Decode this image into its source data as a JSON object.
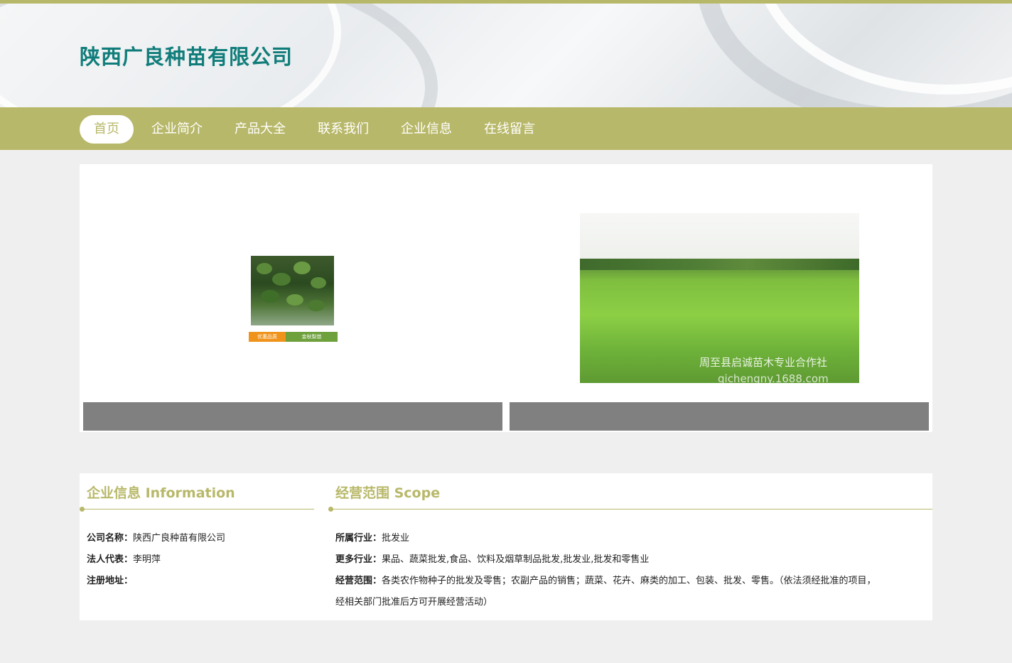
{
  "header": {
    "company_name": "陕西广良种苗有限公司"
  },
  "nav": {
    "items": [
      "首页",
      "企业简介",
      "产品大全",
      "联系我们",
      "企业信息",
      "在线留言"
    ],
    "active_index": 0
  },
  "gallery": {
    "left_badges": [
      "优惠品质",
      "金秋梨苗"
    ],
    "right_watermark": "周至县启诚苗木专业合作社",
    "right_watermark_url": "qichengny.1688.com"
  },
  "company_info": {
    "title": "企业信息 Information",
    "name_label": "公司名称：",
    "name_value": "陕西广良种苗有限公司",
    "rep_label": "法人代表：",
    "rep_value": "李明萍",
    "address_label": "注册地址：",
    "address_value": ""
  },
  "scope": {
    "title": "经营范围 Scope",
    "industry_label": "所属行业：",
    "industry_value": "批发业",
    "more_label": "更多行业：",
    "more_value": "果品、蔬菜批发,食品、饮料及烟草制品批发,批发业,批发和零售业",
    "scope_label": "经营范围：",
    "scope_value_line1": "各类农作物种子的批发及零售；农副产品的销售；蔬菜、花卉、麻类的加工、包装、批发、零售。（依法须经批准的项目，",
    "scope_value_line2": "经相关部门批准后方可开展经营活动）"
  },
  "colors": {
    "accent": "#b8b86a",
    "title": "#107d7a",
    "caption_bar": "#808080"
  }
}
